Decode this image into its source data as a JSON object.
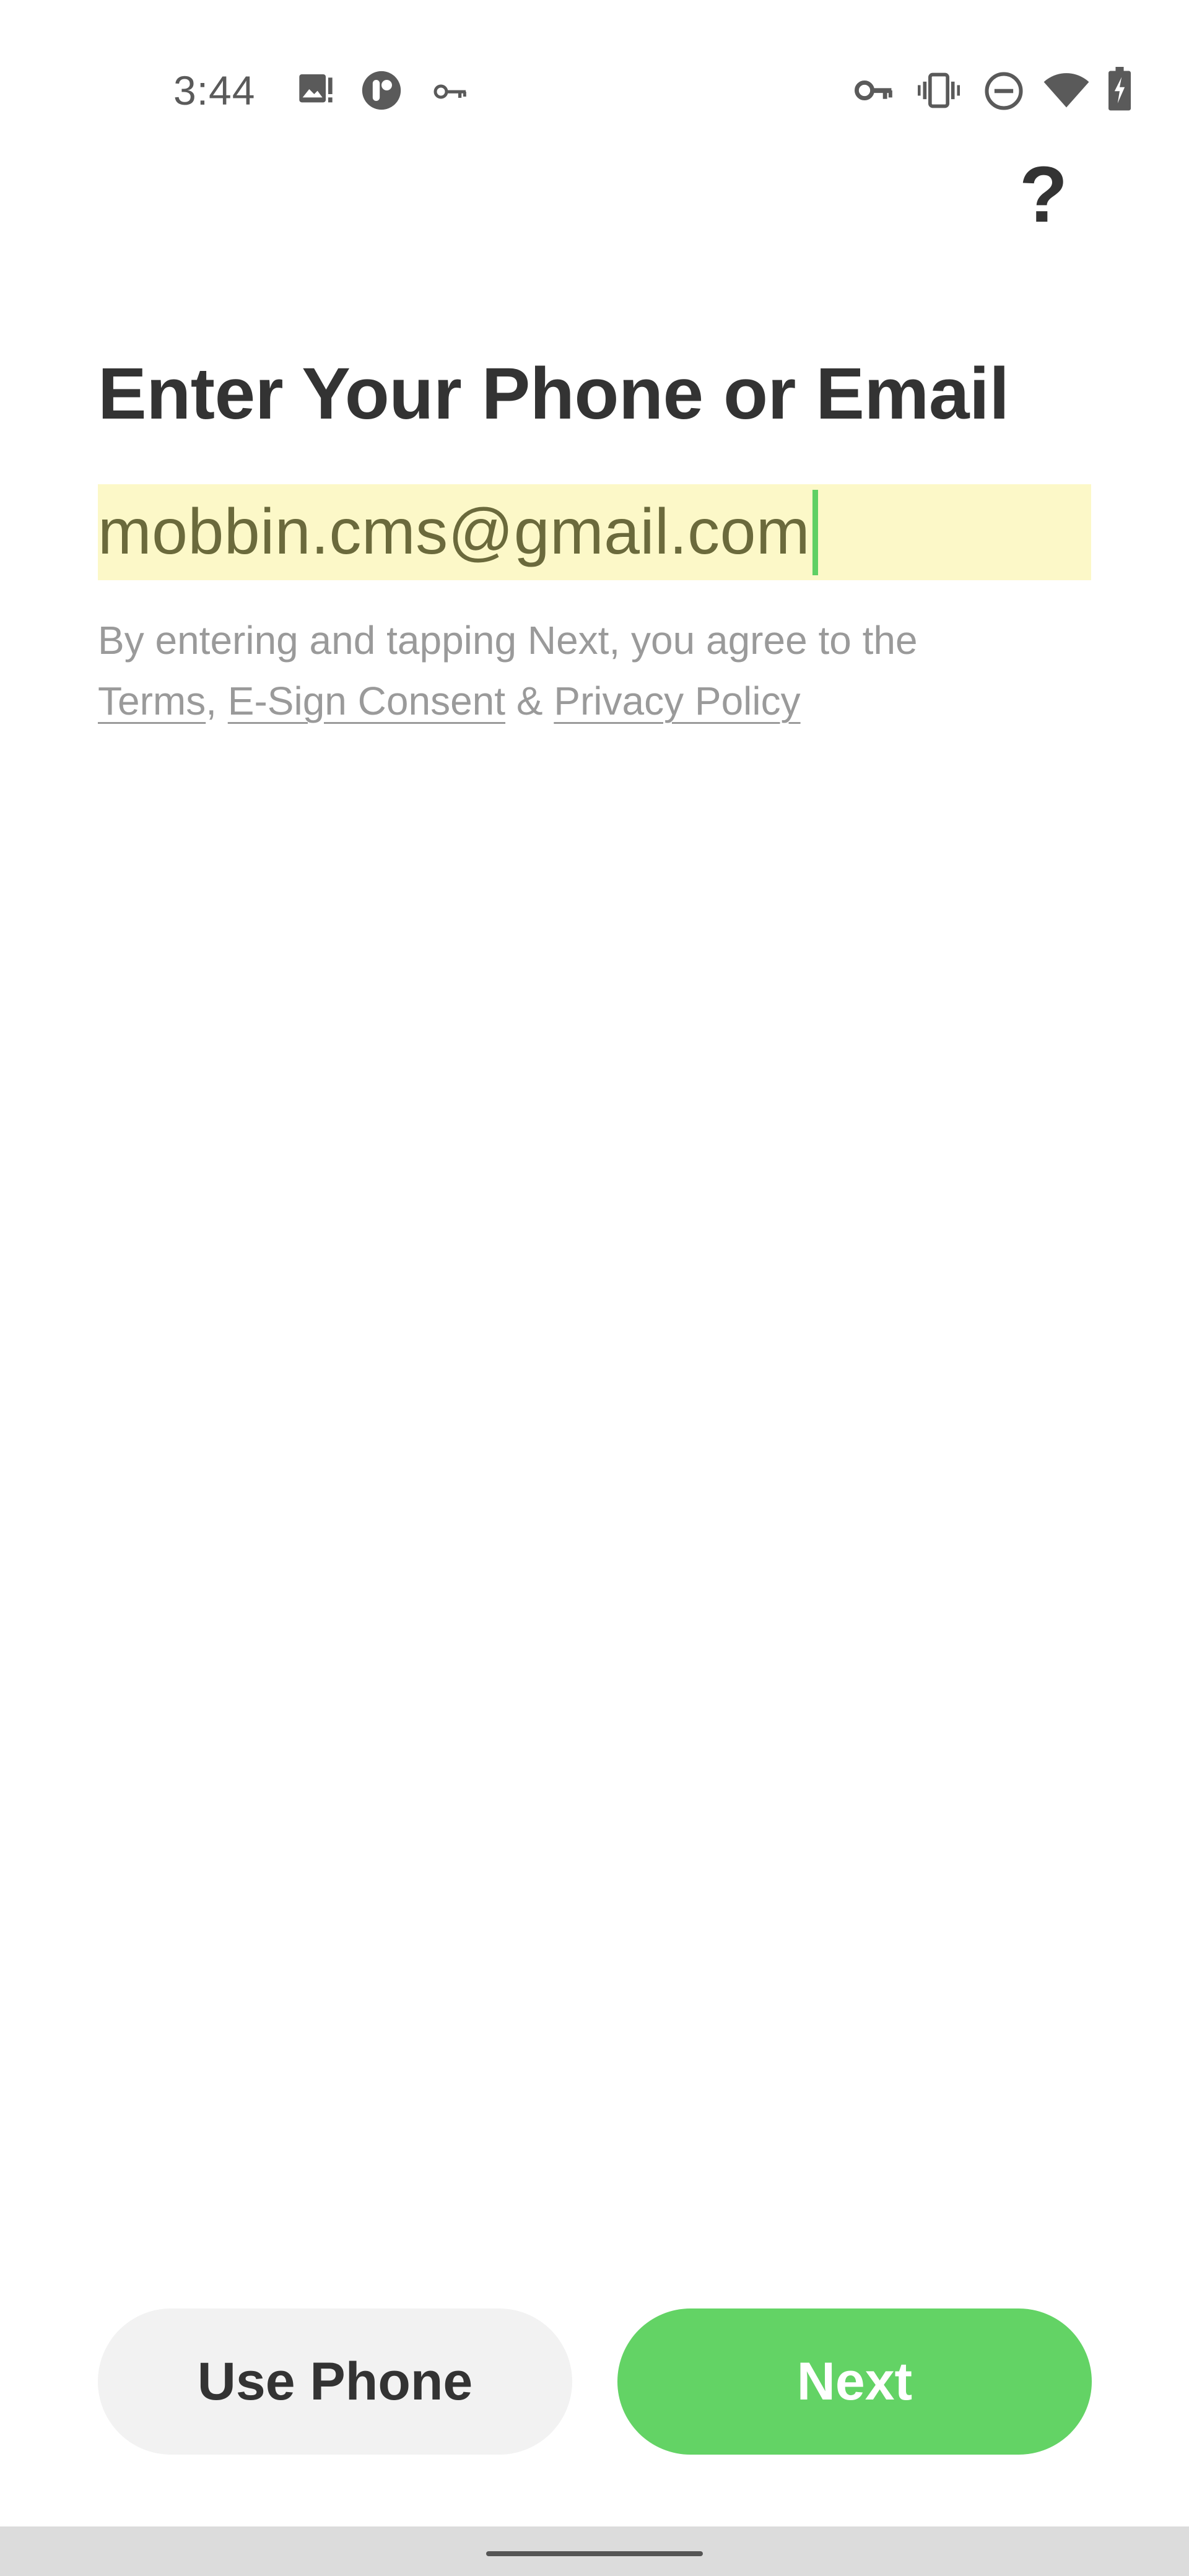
{
  "status_bar": {
    "time": "3:44",
    "left_icons": [
      "image-alert-icon",
      "app-circle-icon",
      "key-icon"
    ],
    "right_icons": [
      "vpn-key-icon",
      "vibrate-icon",
      "do-not-disturb-icon",
      "wifi-icon",
      "battery-charging-icon"
    ]
  },
  "header": {
    "help_label": "?"
  },
  "main": {
    "title": "Enter Your Phone or Email",
    "email_value": "mobbin.cms@gmail.com",
    "legal": {
      "prefix": "By entering and tapping Next, you agree to the",
      "terms": "Terms",
      "comma": ",",
      "esign": "E-Sign Consent",
      "amp": "&",
      "privacy": "Privacy Policy"
    }
  },
  "actions": {
    "use_phone_label": "Use Phone",
    "next_label": "Next"
  },
  "colors": {
    "accent_green": "#63d365",
    "input_highlight": "#fcf8c8",
    "text_dark": "#333333",
    "text_muted": "#9a9a9a"
  }
}
